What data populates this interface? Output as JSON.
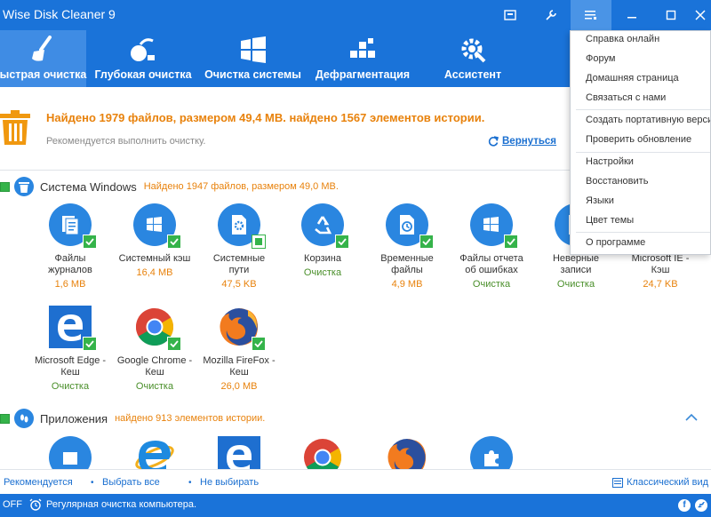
{
  "window": {
    "title": "Wise Disk Cleaner 9",
    "controls": {
      "skin": "skin-icon",
      "tools": "wrench-icon",
      "menu": "menu-icon",
      "minimize": "minimize-icon",
      "maximize": "maximize-icon",
      "close": "close-icon"
    }
  },
  "toolbar": {
    "tabs": [
      {
        "label": "ыстрая очистка",
        "icon": "broom-icon",
        "active": true
      },
      {
        "label": "Глубокая очистка",
        "icon": "vacuum-icon"
      },
      {
        "label": "Очистка системы",
        "icon": "windows-icon"
      },
      {
        "label": "Дефрагментация",
        "icon": "defrag-icon"
      },
      {
        "label": "Ассистент",
        "icon": "gear-icon"
      }
    ]
  },
  "summary": {
    "title": "Найдено 1979 файлов, размером 49,4 MB. найдено 1567 элементов истории.",
    "subtitle": "Рекомендуется выполнить очистку.",
    "back_label": "Вернуться"
  },
  "sections": [
    {
      "title": "Система Windows",
      "note": "Найдено 1947 файлов, размером 49,0 MB.",
      "items": [
        {
          "name": "Файлы\nжурналов",
          "size": "1,6 MB",
          "status": "orange",
          "icon": "log-files-icon"
        },
        {
          "name": "Системный кэш",
          "size": "16,4 MB",
          "status": "orange",
          "icon": "system-cache-icon"
        },
        {
          "name": "Системные\nпути",
          "size": "47,5 KB",
          "status": "orange",
          "icon": "system-paths-icon"
        },
        {
          "name": "Корзина",
          "size": "Очистка",
          "status": "green",
          "icon": "recycle-icon"
        },
        {
          "name": "Временные\nфайлы",
          "size": "4,9 MB",
          "status": "orange",
          "icon": "temp-files-icon"
        },
        {
          "name": "Файлы отчета\nоб ошибках",
          "size": "Очистка",
          "status": "green",
          "icon": "error-report-icon"
        },
        {
          "name": "Неверные\nзаписи",
          "size": "Очистка",
          "status": "green",
          "icon": "invalid-entries-icon"
        },
        {
          "name": "Microsoft IE -\nКэш",
          "size": "24,7 KB",
          "status": "orange",
          "icon": "ie-cache-icon"
        },
        {
          "name": "Microsoft Edge -\nКеш",
          "size": "Очистка",
          "status": "green",
          "icon": "edge-icon"
        },
        {
          "name": "Google Chrome -\nКеш",
          "size": "Очистка",
          "status": "green",
          "icon": "chrome-icon"
        },
        {
          "name": "Mozilla FireFox -\nКеш",
          "size": "26,0 MB",
          "status": "orange",
          "icon": "firefox-icon"
        }
      ]
    },
    {
      "title": "Приложения",
      "note": "найдено 913 элементов истории.",
      "items": [
        {
          "icon": "windows-store-icon"
        },
        {
          "icon": "ie-icon"
        },
        {
          "icon": "edge-icon"
        },
        {
          "icon": "chrome-icon"
        },
        {
          "icon": "firefox-icon"
        },
        {
          "icon": "puzzle-icon"
        }
      ]
    }
  ],
  "footer": {
    "recommended": "Рекомендуется",
    "select_all": "Выбрать все",
    "select_none": "Не выбирать",
    "classic_view": "Классический вид"
  },
  "status": {
    "toggle": "OFF",
    "text": "Регулярная очистка компьютера."
  },
  "menu": {
    "items": [
      "Справка онлайн",
      "Форум",
      "Домашняя страница",
      "Связаться с нами",
      "Создать портативную версию",
      "Проверить обновление",
      "Настройки",
      "Восстановить",
      "Языки",
      "Цвет темы",
      "О программе"
    ]
  },
  "colors": {
    "brand_blue": "#1a73d9",
    "accent_orange": "#e8820c",
    "ok_green": "#35b34a",
    "link_blue": "#1a6fd0"
  }
}
